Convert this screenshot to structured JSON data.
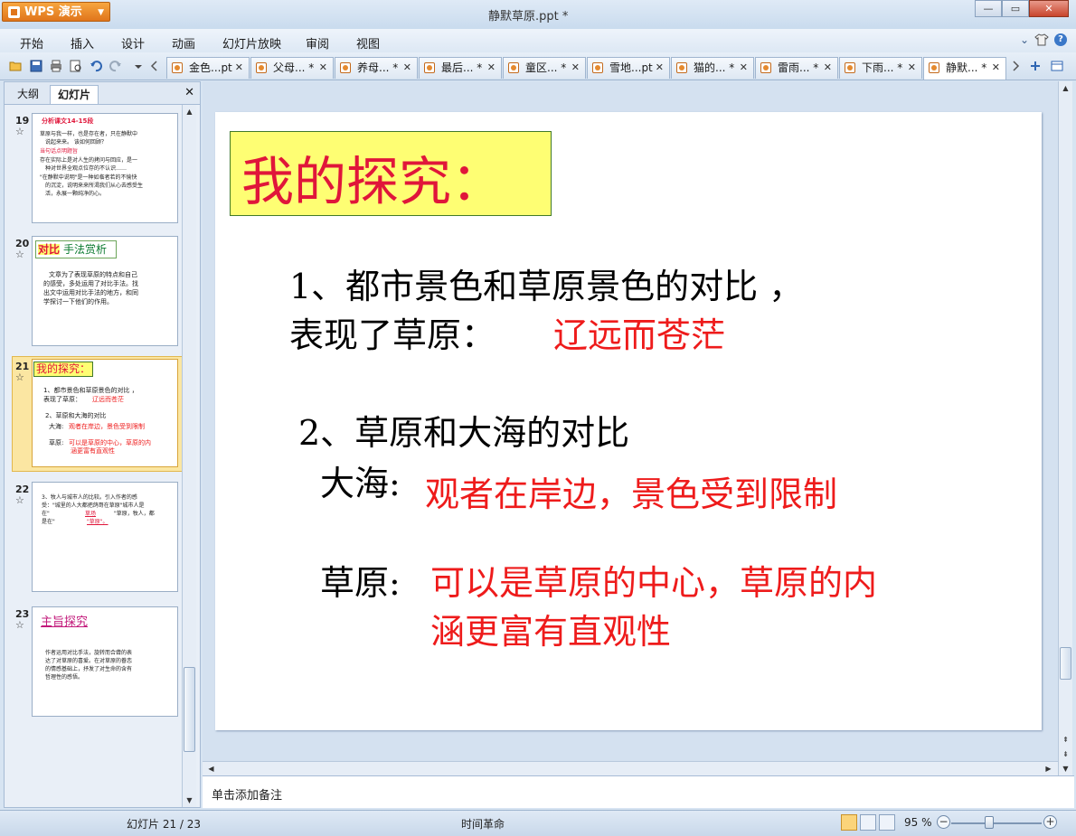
{
  "app": {
    "logo_label": "WPS 演示",
    "doc_title": "静默草原.ppt *"
  },
  "window_controls": {
    "minimize": "—",
    "maximize": "▭",
    "close": "✕"
  },
  "menu": [
    "开始",
    "插入",
    "设计",
    "动画",
    "幻灯片放映",
    "审阅",
    "视图"
  ],
  "menu_right": {
    "collapse": "⌄",
    "help": "?"
  },
  "doc_tabs": [
    {
      "label": "金色...pt",
      "active": false
    },
    {
      "label": "父母... *",
      "active": false
    },
    {
      "label": "养母... *",
      "active": false
    },
    {
      "label": "最后... *",
      "active": false
    },
    {
      "label": "童区... *",
      "active": false
    },
    {
      "label": "雪地...pt",
      "active": false
    },
    {
      "label": "猫的... *",
      "active": false
    },
    {
      "label": "雷雨... *",
      "active": false
    },
    {
      "label": "下雨... *",
      "active": false
    },
    {
      "label": "静默... *",
      "active": true
    }
  ],
  "left_panel": {
    "tabs": [
      "大纲",
      "幻灯片"
    ],
    "active_tab": "幻灯片",
    "close": "✕",
    "thumbnails": [
      {
        "number": "19",
        "star": "☆",
        "title": "分析课文14-15段",
        "lines": [
          "草原与我一样，也是存在者，只在静默中",
          "说起来来。  该如何回顾？",
          "当句话点明题旨",
          "存在实际上是对人生的拷问与回应，是一",
          "种对世界全观点位存的不认识……",
          "\"在静默中说明\"是一种如临者若的不愉快",
          "的沉淀，说明来来所渴我们从心去感受生",
          "活，永展一颗纯净的心。"
        ]
      },
      {
        "number": "20",
        "star": "☆",
        "title_a": "对比",
        "title_b": "手法赏析",
        "lines": [
          "文章为了表现草原的特点和自己",
          "的感受，多处运用了对比手法。找",
          "出文中运用对比手法的地方，和同",
          "学探讨一下他们的作用。"
        ]
      },
      {
        "number": "21",
        "star": "☆",
        "title": "我的探究：",
        "lines": [
          "1、都市景色和草原景色的对比 ，",
          "表现了草原： ",
          "辽远而苍茫",
          "2、草原和大海的对比",
          "大海: ",
          "观者在岸边，景色受到限制",
          "草原: ",
          "可以是草原的中心，草原的内",
          "涵更富有直观性"
        ]
      },
      {
        "number": "22",
        "star": "☆",
        "lines": [
          "3、牧人与城市人的比较。引入作者的感",
          "受：\"城里的人大都把鸽哥在草原\"城市人是",
          "在\"",
          "草场",
          "\"草原，牧人，都",
          "是在\"",
          "\"草原\"。"
        ]
      },
      {
        "number": "23",
        "star": "☆",
        "title": "主旨探究",
        "lines": [
          "作者运用对比手法，旋转而合聋的表",
          "达了对草原的喜爱。在对草原的眷恋",
          "的情感基础上，抒发了对生命的含有",
          "哲理性的感悟。"
        ]
      }
    ]
  },
  "slide": {
    "title": "我的探究：",
    "item1_line1": "1、都市景色和草原景色的对比 ，",
    "item1_line2_label": "表现了草原：",
    "item1_answer": "辽远而苍茫",
    "item2_heading": "2、草原和大海的对比",
    "sea_label": "大海:",
    "sea_answer": "观者在岸边，景色受到限制",
    "grass_label": "草原:",
    "grass_answer_line1": "可以是草原的中心，草原的内",
    "grass_answer_line2": "涵更富有直观性"
  },
  "notes_placeholder": "单击添加备注",
  "status": {
    "slide_counter": "幻灯片 21 / 23",
    "theme": "时间革命",
    "zoom": "95 %",
    "zoom_level": 0.42
  },
  "colors": {
    "accent_red": "#ee1b1b",
    "title_red": "#e0163a",
    "title_bg": "#fefe73",
    "selected_thumb": "#fbe6a2"
  }
}
